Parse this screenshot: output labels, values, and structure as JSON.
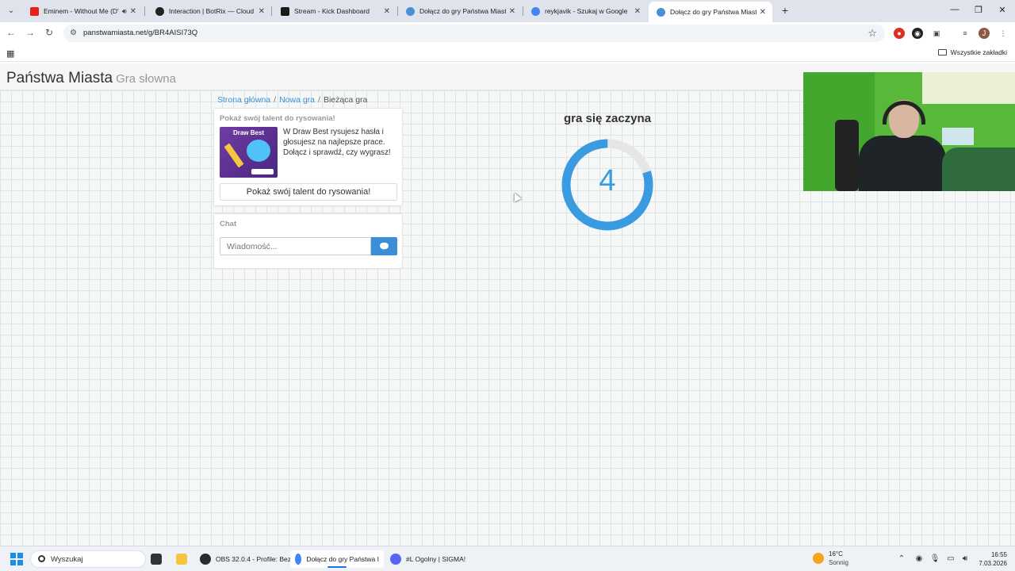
{
  "browser": {
    "tabs": [
      {
        "title": "Eminem - Without Me (D'A",
        "favicon_color": "#e62117",
        "audio": true
      },
      {
        "title": "Interaction | BotRix — Cloud St",
        "favicon_color": "#222222"
      },
      {
        "title": "Stream - Kick Dashboard",
        "favicon_color": "#1a1a1a"
      },
      {
        "title": "Dołącz do gry Państwa Miasta",
        "favicon_color": "#4a90d9"
      },
      {
        "title": "reykjavik - Szukaj w Google",
        "favicon_color": "#4285f4"
      },
      {
        "title": "Dołącz do gry Państwa Miasta",
        "favicon_color": "#4a90d9",
        "active": true
      }
    ],
    "url": "panstwamiasta.net/g/BR4AISI73Q",
    "bookmarks_all_label": "Wszystkie zakładki"
  },
  "site": {
    "brand": "Państwa Miasta",
    "brand_sub": "Gra słowna",
    "breadcrumb": [
      "Strona główna",
      "Nowa gra",
      "Bieżąca gra"
    ],
    "promo": {
      "heading": "Pokaż swój talent do rysowania!",
      "image_title": "Draw Best",
      "text": "W Draw Best rysujesz hasła i głosujesz na najlepsze prace. Dołącz i sprawdź, czy wygrasz!",
      "button": "Pokaż swój talent do rysowania!"
    },
    "chat": {
      "heading": "Chat",
      "placeholder": "Wiadomość..."
    },
    "game": {
      "status": "gra się zaczyna",
      "countdown": "4",
      "countdown_fraction": 0.8,
      "ring_color": "#3a9be0",
      "ring_track_color": "#e6e6e6"
    }
  },
  "taskbar": {
    "search_placeholder": "Wyszukaj",
    "apps": [
      {
        "label": "OBS 32.0.4 - Profile: Bez",
        "color": "#2b2b2b"
      },
      {
        "label": "Dołącz do gry Państwa I",
        "color": "#4285f4",
        "active": true
      },
      {
        "label": "#L  Ogolny | SIGMA!",
        "color": "#5865f2"
      }
    ],
    "weather_temp": "16°C",
    "weather_desc": "Sonnig",
    "time": "16:55",
    "date": "7.03.2026"
  }
}
